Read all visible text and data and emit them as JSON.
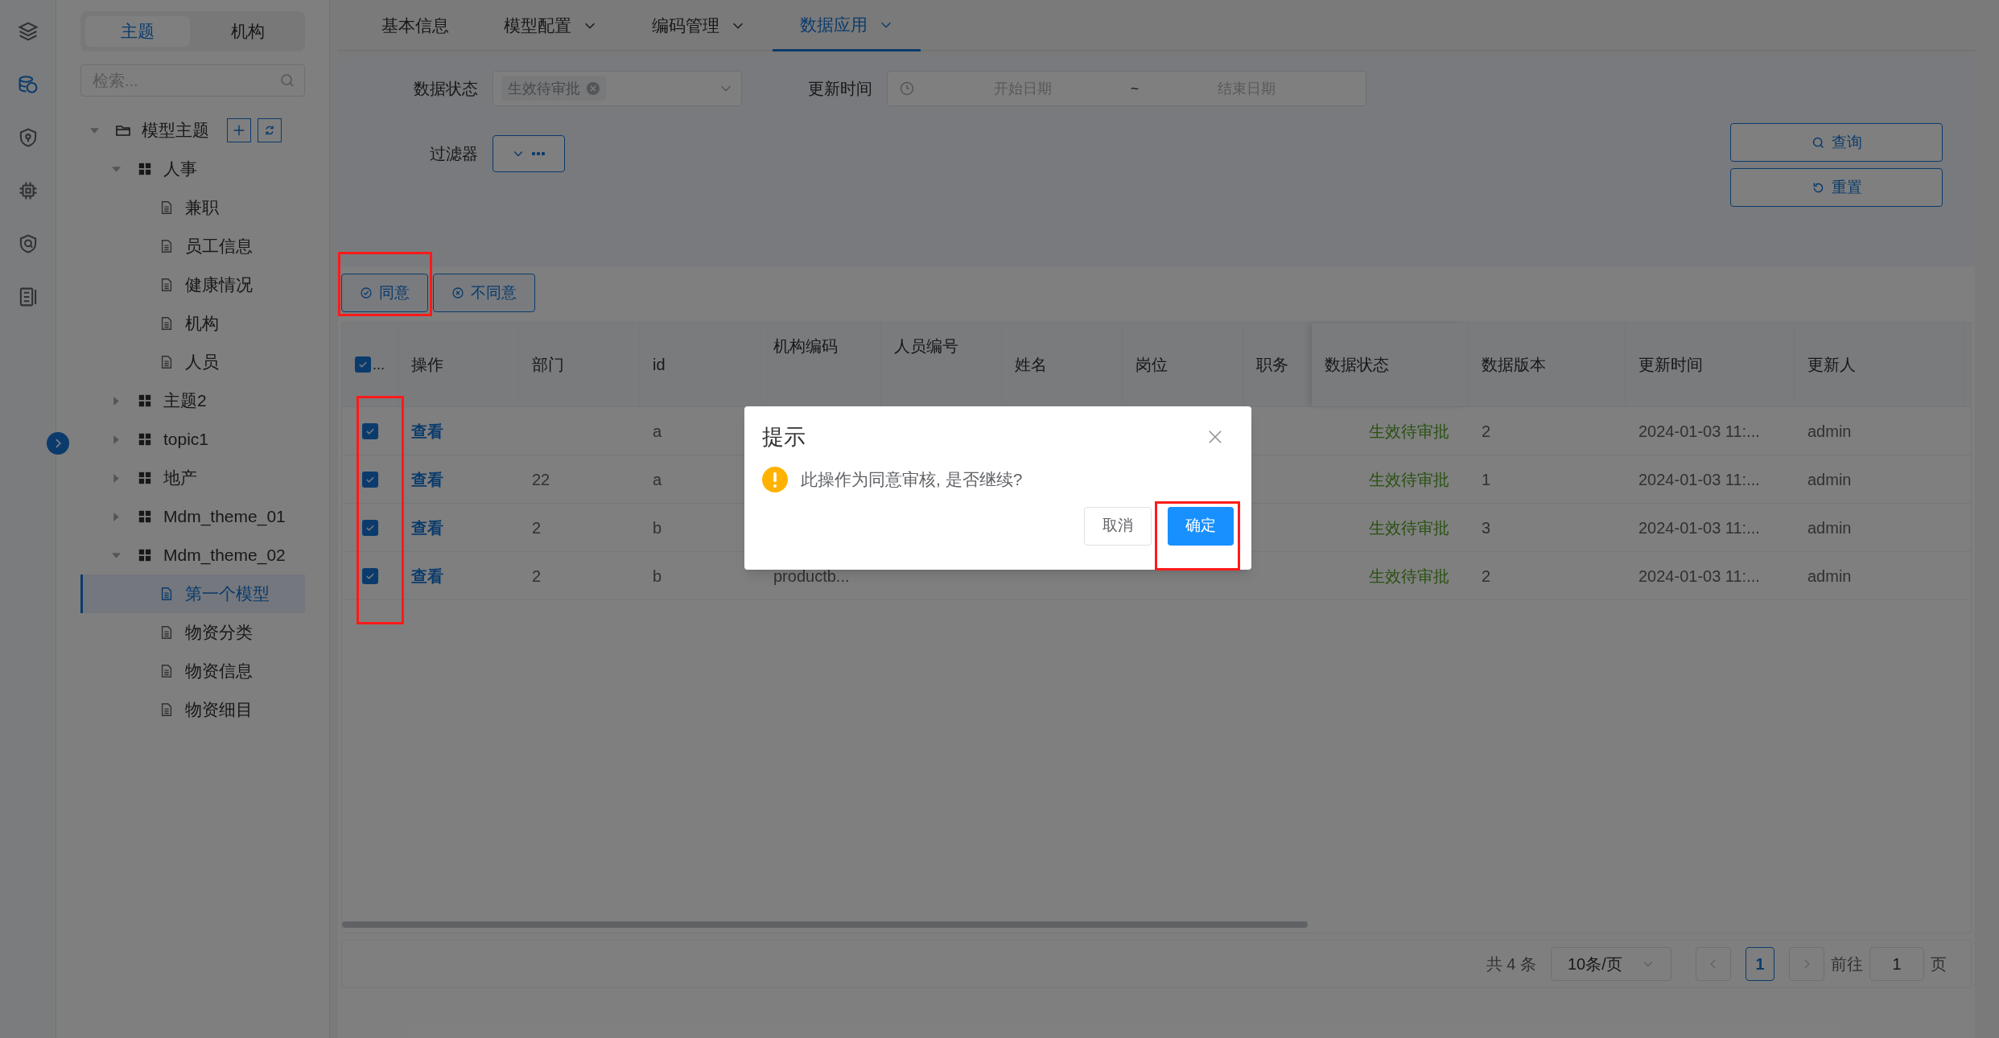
{
  "rail": {
    "items": [
      {
        "kind": "layers",
        "selected": false
      },
      {
        "kind": "database",
        "selected": true
      },
      {
        "kind": "shield",
        "selected": false
      },
      {
        "kind": "chip",
        "selected": false
      },
      {
        "kind": "search-shield",
        "selected": false
      },
      {
        "kind": "document",
        "selected": false
      }
    ]
  },
  "side_tabs": [
    {
      "label": "主题",
      "selected": true
    },
    {
      "label": "机构",
      "selected": false
    }
  ],
  "search": {
    "placeholder": "检索..."
  },
  "tree": [
    {
      "label": "模型主题",
      "kind": "folder",
      "expanded": true,
      "selected": false,
      "children": [
        {
          "label": "人事",
          "kind": "group",
          "expanded": true,
          "selected": false,
          "children": [
            {
              "label": "兼职",
              "kind": "doc",
              "selected": false
            },
            {
              "label": "员工信息",
              "kind": "doc",
              "selected": false
            },
            {
              "label": "健康情况",
              "kind": "doc",
              "selected": false
            },
            {
              "label": "机构",
              "kind": "doc",
              "selected": false
            },
            {
              "label": "人员",
              "kind": "doc",
              "selected": false
            }
          ]
        },
        {
          "label": "主题2",
          "kind": "group",
          "expanded": false,
          "selected": false
        },
        {
          "label": "topic1",
          "kind": "group",
          "expanded": false,
          "selected": false
        },
        {
          "label": "地产",
          "kind": "group",
          "expanded": false,
          "selected": false
        },
        {
          "label": "Mdm_theme_01",
          "kind": "group",
          "expanded": false,
          "selected": false
        },
        {
          "label": "Mdm_theme_02",
          "kind": "group",
          "expanded": true,
          "selected": false,
          "children": [
            {
              "label": "第一个模型",
              "kind": "doc",
              "selected": true
            },
            {
              "label": "物资分类",
              "kind": "doc",
              "selected": false
            },
            {
              "label": "物资信息",
              "kind": "doc",
              "selected": false
            },
            {
              "label": "物资细目",
              "kind": "doc",
              "selected": false
            }
          ]
        }
      ]
    }
  ],
  "tabs": [
    {
      "label": "基本信息",
      "dropdown": false,
      "selected": false
    },
    {
      "label": "模型配置",
      "dropdown": true,
      "selected": false
    },
    {
      "label": "编码管理",
      "dropdown": true,
      "selected": false
    },
    {
      "label": "数据应用",
      "dropdown": true,
      "selected": true
    }
  ],
  "filters": {
    "status_label": "数据状态",
    "status_tag": "生效待审批",
    "time_label": "更新时间",
    "start_placeholder": "开始日期",
    "range_sep": "~",
    "end_placeholder": "结束日期",
    "filter_label": "过滤器",
    "query_button": "查询",
    "reset_button": "重置"
  },
  "actions": [
    {
      "label": "同意",
      "kind": "approve"
    },
    {
      "label": "不同意",
      "kind": "reject"
    }
  ],
  "table": {
    "select_all": {
      "checked": true,
      "label": "..."
    },
    "columns": [
      "操作",
      "部门",
      "id",
      "机构编码",
      "人员编号",
      "姓名",
      "岗位",
      "职务",
      "数据状态",
      "数据版本",
      "更新时间",
      "更新人"
    ],
    "rows": [
      {
        "checked": true,
        "cells": [
          "查看",
          null,
          "a",
          null,
          null,
          null,
          null,
          null,
          "生效待审批",
          "2",
          "2024-01-03 11:...",
          "admin"
        ]
      },
      {
        "checked": true,
        "cells": [
          "查看",
          "22",
          "a",
          null,
          null,
          null,
          null,
          null,
          "生效待审批",
          "1",
          "2024-01-03 11:...",
          "admin"
        ]
      },
      {
        "checked": true,
        "cells": [
          "查看",
          "2",
          "b",
          null,
          null,
          null,
          null,
          null,
          "生效待审批",
          "3",
          "2024-01-03 11:...",
          "admin"
        ]
      },
      {
        "checked": true,
        "cells": [
          "查看",
          "2",
          "b",
          "productb...",
          null,
          null,
          null,
          null,
          "生效待审批",
          "2",
          "2024-01-03 11:...",
          "admin"
        ]
      }
    ]
  },
  "pagination": {
    "total": "共 4 条",
    "page_size": "10条/页",
    "pages": [
      {
        "label": "1",
        "selected": true
      }
    ],
    "goto_label": "前往",
    "goto_value": "1",
    "page_unit": "页"
  },
  "dialog": {
    "title": "提示",
    "message": "此操作为同意审核, 是否继续?",
    "buttons": [
      {
        "label": "取消",
        "kind": "secondary"
      },
      {
        "label": "确定",
        "kind": "primary"
      }
    ]
  }
}
